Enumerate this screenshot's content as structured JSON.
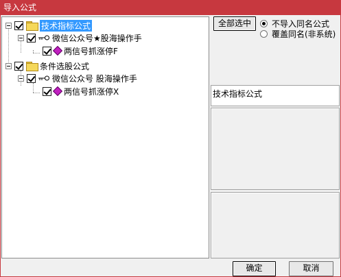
{
  "window": {
    "title": "导入公式"
  },
  "tree": {
    "nodes": [
      {
        "label": "技术指标公式",
        "checked": true,
        "selected": true,
        "icon": "folder-icon"
      },
      {
        "label": "微信公众号★股海操作手",
        "checked": true,
        "icon": "key-icon"
      },
      {
        "label": "两信号抓涨停F",
        "checked": true,
        "icon": "formula-gem-icon"
      },
      {
        "label": "条件选股公式",
        "checked": true,
        "icon": "folder-icon"
      },
      {
        "label": "微信公众号 股海操作手",
        "checked": true,
        "icon": "key-icon"
      },
      {
        "label": "两信号抓涨停X",
        "checked": true,
        "icon": "formula-gem-icon"
      }
    ]
  },
  "options": {
    "select_all_label": "全部选中",
    "radio_no_import": "不导入同名公式",
    "radio_overwrite": "覆盖同名(非系统)",
    "selected_radio": "no_import"
  },
  "info": {
    "category_label": "技术指标公式"
  },
  "footer": {
    "ok_label": "确定",
    "cancel_label": "取消"
  }
}
